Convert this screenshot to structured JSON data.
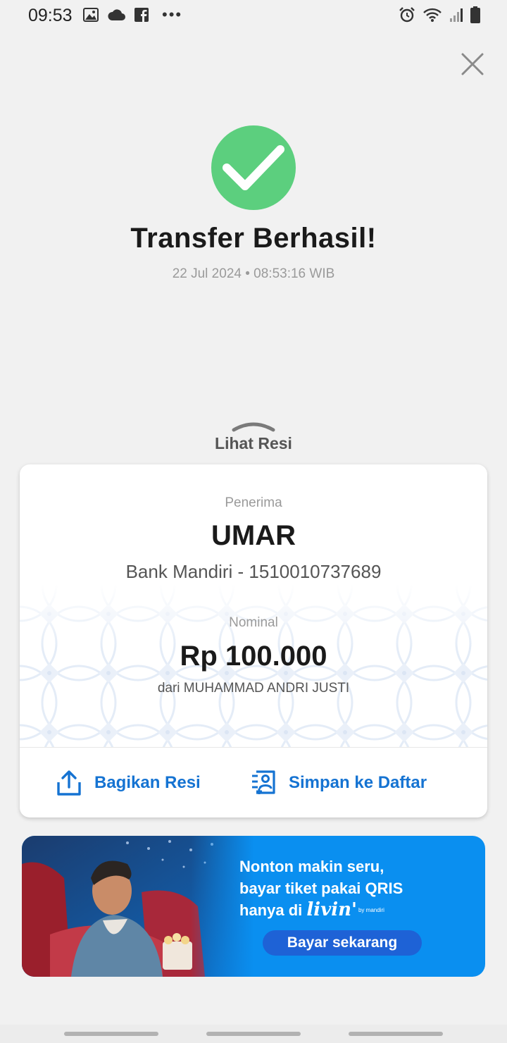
{
  "status_bar": {
    "time": "09:53",
    "left_icons": [
      "gallery-icon",
      "cloud-icon",
      "facebook-icon",
      "more-dots-icon"
    ],
    "more": "•••",
    "right_icons": [
      "alarm-icon",
      "wifi-icon",
      "signal-icon",
      "battery-icon"
    ]
  },
  "header": {
    "close_icon": "close-icon"
  },
  "result": {
    "title": "Transfer Berhasil!",
    "datetime": "22 Jul 2024 • 08:53:16 WIB",
    "status_color": "#5ccf7e"
  },
  "receipt_toggle": {
    "label": "Lihat Resi",
    "icon": "chevron-up-icon"
  },
  "receipt": {
    "recipient_label": "Penerima",
    "recipient_name": "UMAR",
    "recipient_account": "Bank Mandiri - 1510010737689",
    "amount_label": "Nominal",
    "amount": "Rp 100.000",
    "sender": "dari MUHAMMAD ANDRI JUSTI",
    "actions": [
      {
        "label": "Bagikan Resi",
        "icon": "share-icon"
      },
      {
        "label": "Simpan ke Daftar",
        "icon": "save-contact-icon"
      }
    ],
    "action_color": "#1573d2"
  },
  "promo": {
    "line1": "Nonton makin seru,",
    "line2": "bayar tiket pakai QRIS",
    "line3_prefix": "hanya di",
    "brand": "livin'",
    "brand_sub": "by mandiri",
    "cta": "Bayar sekarang",
    "background_color": "#0a8ff0"
  }
}
